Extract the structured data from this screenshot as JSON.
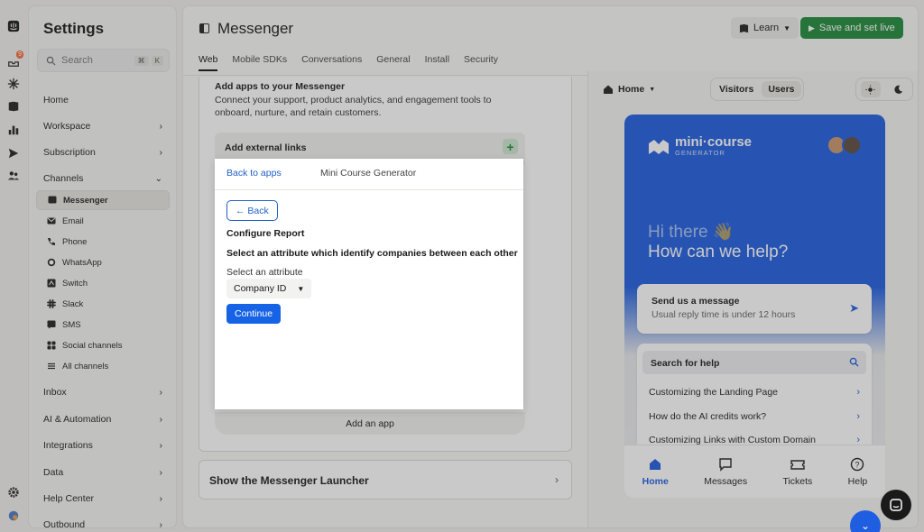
{
  "settings": {
    "title": "Settings",
    "search_placeholder": "Search",
    "kbd": [
      "⌘",
      "K"
    ],
    "nav": [
      {
        "label": "Home",
        "chevron": ""
      },
      {
        "label": "Workspace",
        "chevron": "›"
      },
      {
        "label": "Subscription",
        "chevron": "›"
      },
      {
        "label": "Channels",
        "chevron": "⌄"
      }
    ],
    "channels": [
      {
        "label": "Messenger",
        "icon": "messenger-icon",
        "active": true
      },
      {
        "label": "Email",
        "icon": "email-icon"
      },
      {
        "label": "Phone",
        "icon": "phone-icon"
      },
      {
        "label": "WhatsApp",
        "icon": "whatsapp-icon"
      },
      {
        "label": "Switch",
        "icon": "switch-icon"
      },
      {
        "label": "Slack",
        "icon": "slack-icon"
      },
      {
        "label": "SMS",
        "icon": "sms-icon"
      },
      {
        "label": "Social channels",
        "icon": "social-icon"
      },
      {
        "label": "All channels",
        "icon": "list-icon"
      }
    ],
    "nav_bottom": [
      {
        "label": "Inbox",
        "chevron": "›"
      },
      {
        "label": "AI & Automation",
        "chevron": "›"
      },
      {
        "label": "Integrations",
        "chevron": "›"
      },
      {
        "label": "Data",
        "chevron": "›"
      },
      {
        "label": "Help Center",
        "chevron": "›"
      },
      {
        "label": "Outbound",
        "chevron": "›"
      }
    ]
  },
  "rail": {
    "badge": "9"
  },
  "header": {
    "title": "Messenger",
    "learn": "Learn",
    "save": "Save and set live",
    "tabs": [
      "Web",
      "Mobile SDKs",
      "Conversations",
      "General",
      "Install",
      "Security"
    ],
    "active_tab": "Web"
  },
  "apps_section": {
    "heading": "Add apps to your Messenger",
    "description": "Connect your support, product analytics, and engagement tools to onboard, nurture, and retain customers.",
    "external_links": "Add external links",
    "plus": "+",
    "add_app": "Add an app"
  },
  "launcher": {
    "label": "Show the Messenger Launcher",
    "chevron": "›"
  },
  "modal": {
    "back_to_apps": "Back to apps",
    "app_name": "Mini Course Generator",
    "back": "← Back",
    "configure": "Configure Report",
    "question": "Select an attribute which identify companies between each other",
    "select_label": "Select an attribute",
    "selected": "Company ID",
    "continue": "Continue"
  },
  "preview": {
    "home": "Home",
    "segments": [
      "Visitors",
      "Users"
    ],
    "active_segment": "Users",
    "logo_title": "mini·course",
    "logo_sub": "GENERATOR",
    "greet1": "Hi there 👋",
    "greet2": "How can we help?",
    "send_title": "Send us a message",
    "send_sub": "Usual reply time is under 12 hours",
    "help_search": "Search for help",
    "help_items": [
      "Customizing the Landing Page",
      "How do the AI credits work?",
      "Customizing Links with Custom Domain"
    ],
    "nav": [
      "Home",
      "Messages",
      "Tickets",
      "Help"
    ],
    "brand_color": "#1f5ee0"
  }
}
